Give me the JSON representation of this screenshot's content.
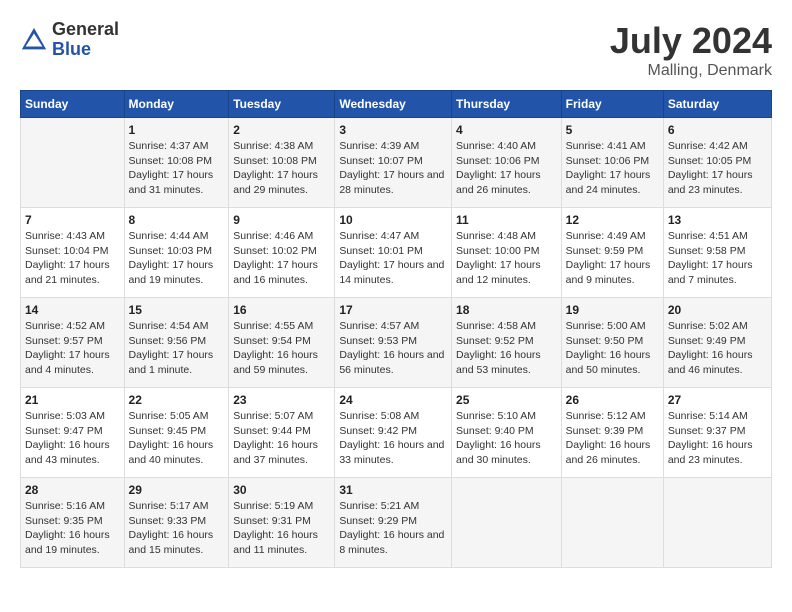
{
  "header": {
    "logo_general": "General",
    "logo_blue": "Blue",
    "month_year": "July 2024",
    "location": "Malling, Denmark"
  },
  "weekdays": [
    "Sunday",
    "Monday",
    "Tuesday",
    "Wednesday",
    "Thursday",
    "Friday",
    "Saturday"
  ],
  "weeks": [
    [
      {
        "day": "",
        "sunrise": "",
        "sunset": "",
        "daylight": ""
      },
      {
        "day": "1",
        "sunrise": "Sunrise: 4:37 AM",
        "sunset": "Sunset: 10:08 PM",
        "daylight": "Daylight: 17 hours and 31 minutes."
      },
      {
        "day": "2",
        "sunrise": "Sunrise: 4:38 AM",
        "sunset": "Sunset: 10:08 PM",
        "daylight": "Daylight: 17 hours and 29 minutes."
      },
      {
        "day": "3",
        "sunrise": "Sunrise: 4:39 AM",
        "sunset": "Sunset: 10:07 PM",
        "daylight": "Daylight: 17 hours and 28 minutes."
      },
      {
        "day": "4",
        "sunrise": "Sunrise: 4:40 AM",
        "sunset": "Sunset: 10:06 PM",
        "daylight": "Daylight: 17 hours and 26 minutes."
      },
      {
        "day": "5",
        "sunrise": "Sunrise: 4:41 AM",
        "sunset": "Sunset: 10:06 PM",
        "daylight": "Daylight: 17 hours and 24 minutes."
      },
      {
        "day": "6",
        "sunrise": "Sunrise: 4:42 AM",
        "sunset": "Sunset: 10:05 PM",
        "daylight": "Daylight: 17 hours and 23 minutes."
      }
    ],
    [
      {
        "day": "7",
        "sunrise": "Sunrise: 4:43 AM",
        "sunset": "Sunset: 10:04 PM",
        "daylight": "Daylight: 17 hours and 21 minutes."
      },
      {
        "day": "8",
        "sunrise": "Sunrise: 4:44 AM",
        "sunset": "Sunset: 10:03 PM",
        "daylight": "Daylight: 17 hours and 19 minutes."
      },
      {
        "day": "9",
        "sunrise": "Sunrise: 4:46 AM",
        "sunset": "Sunset: 10:02 PM",
        "daylight": "Daylight: 17 hours and 16 minutes."
      },
      {
        "day": "10",
        "sunrise": "Sunrise: 4:47 AM",
        "sunset": "Sunset: 10:01 PM",
        "daylight": "Daylight: 17 hours and 14 minutes."
      },
      {
        "day": "11",
        "sunrise": "Sunrise: 4:48 AM",
        "sunset": "Sunset: 10:00 PM",
        "daylight": "Daylight: 17 hours and 12 minutes."
      },
      {
        "day": "12",
        "sunrise": "Sunrise: 4:49 AM",
        "sunset": "Sunset: 9:59 PM",
        "daylight": "Daylight: 17 hours and 9 minutes."
      },
      {
        "day": "13",
        "sunrise": "Sunrise: 4:51 AM",
        "sunset": "Sunset: 9:58 PM",
        "daylight": "Daylight: 17 hours and 7 minutes."
      }
    ],
    [
      {
        "day": "14",
        "sunrise": "Sunrise: 4:52 AM",
        "sunset": "Sunset: 9:57 PM",
        "daylight": "Daylight: 17 hours and 4 minutes."
      },
      {
        "day": "15",
        "sunrise": "Sunrise: 4:54 AM",
        "sunset": "Sunset: 9:56 PM",
        "daylight": "Daylight: 17 hours and 1 minute."
      },
      {
        "day": "16",
        "sunrise": "Sunrise: 4:55 AM",
        "sunset": "Sunset: 9:54 PM",
        "daylight": "Daylight: 16 hours and 59 minutes."
      },
      {
        "day": "17",
        "sunrise": "Sunrise: 4:57 AM",
        "sunset": "Sunset: 9:53 PM",
        "daylight": "Daylight: 16 hours and 56 minutes."
      },
      {
        "day": "18",
        "sunrise": "Sunrise: 4:58 AM",
        "sunset": "Sunset: 9:52 PM",
        "daylight": "Daylight: 16 hours and 53 minutes."
      },
      {
        "day": "19",
        "sunrise": "Sunrise: 5:00 AM",
        "sunset": "Sunset: 9:50 PM",
        "daylight": "Daylight: 16 hours and 50 minutes."
      },
      {
        "day": "20",
        "sunrise": "Sunrise: 5:02 AM",
        "sunset": "Sunset: 9:49 PM",
        "daylight": "Daylight: 16 hours and 46 minutes."
      }
    ],
    [
      {
        "day": "21",
        "sunrise": "Sunrise: 5:03 AM",
        "sunset": "Sunset: 9:47 PM",
        "daylight": "Daylight: 16 hours and 43 minutes."
      },
      {
        "day": "22",
        "sunrise": "Sunrise: 5:05 AM",
        "sunset": "Sunset: 9:45 PM",
        "daylight": "Daylight: 16 hours and 40 minutes."
      },
      {
        "day": "23",
        "sunrise": "Sunrise: 5:07 AM",
        "sunset": "Sunset: 9:44 PM",
        "daylight": "Daylight: 16 hours and 37 minutes."
      },
      {
        "day": "24",
        "sunrise": "Sunrise: 5:08 AM",
        "sunset": "Sunset: 9:42 PM",
        "daylight": "Daylight: 16 hours and 33 minutes."
      },
      {
        "day": "25",
        "sunrise": "Sunrise: 5:10 AM",
        "sunset": "Sunset: 9:40 PM",
        "daylight": "Daylight: 16 hours and 30 minutes."
      },
      {
        "day": "26",
        "sunrise": "Sunrise: 5:12 AM",
        "sunset": "Sunset: 9:39 PM",
        "daylight": "Daylight: 16 hours and 26 minutes."
      },
      {
        "day": "27",
        "sunrise": "Sunrise: 5:14 AM",
        "sunset": "Sunset: 9:37 PM",
        "daylight": "Daylight: 16 hours and 23 minutes."
      }
    ],
    [
      {
        "day": "28",
        "sunrise": "Sunrise: 5:16 AM",
        "sunset": "Sunset: 9:35 PM",
        "daylight": "Daylight: 16 hours and 19 minutes."
      },
      {
        "day": "29",
        "sunrise": "Sunrise: 5:17 AM",
        "sunset": "Sunset: 9:33 PM",
        "daylight": "Daylight: 16 hours and 15 minutes."
      },
      {
        "day": "30",
        "sunrise": "Sunrise: 5:19 AM",
        "sunset": "Sunset: 9:31 PM",
        "daylight": "Daylight: 16 hours and 11 minutes."
      },
      {
        "day": "31",
        "sunrise": "Sunrise: 5:21 AM",
        "sunset": "Sunset: 9:29 PM",
        "daylight": "Daylight: 16 hours and 8 minutes."
      },
      {
        "day": "",
        "sunrise": "",
        "sunset": "",
        "daylight": ""
      },
      {
        "day": "",
        "sunrise": "",
        "sunset": "",
        "daylight": ""
      },
      {
        "day": "",
        "sunrise": "",
        "sunset": "",
        "daylight": ""
      }
    ]
  ]
}
